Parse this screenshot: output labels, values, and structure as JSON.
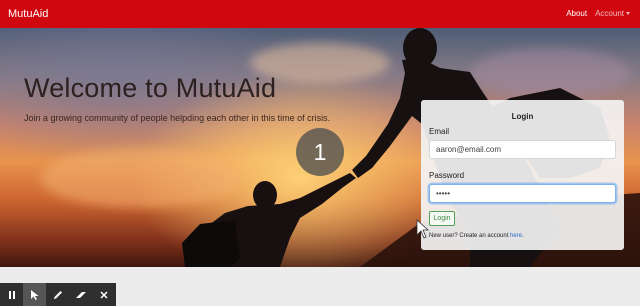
{
  "navbar": {
    "brand": "MutuAid",
    "about": "About",
    "account": "Account"
  },
  "hero": {
    "title": "Welcome to MutuAid",
    "subtitle": "Join a growing community of people helpding each other in this time of crisis.",
    "counter": "1"
  },
  "login": {
    "title": "Login",
    "email_label": "Email",
    "email_value": "aaron@email.com",
    "password_label": "Password",
    "password_value": "•••••",
    "button": "Login",
    "new_user_text": "New user? Create an account ",
    "here_link": "here",
    "period": "."
  },
  "toolbar": {
    "tools": [
      "pause-icon",
      "pointer-icon",
      "pencil-icon",
      "eraser-icon",
      "close-icon"
    ],
    "active": "pointer-icon"
  },
  "colors": {
    "navbar": "#d0070f",
    "login_button": "#3e8a3e",
    "link": "#2b67c8"
  }
}
